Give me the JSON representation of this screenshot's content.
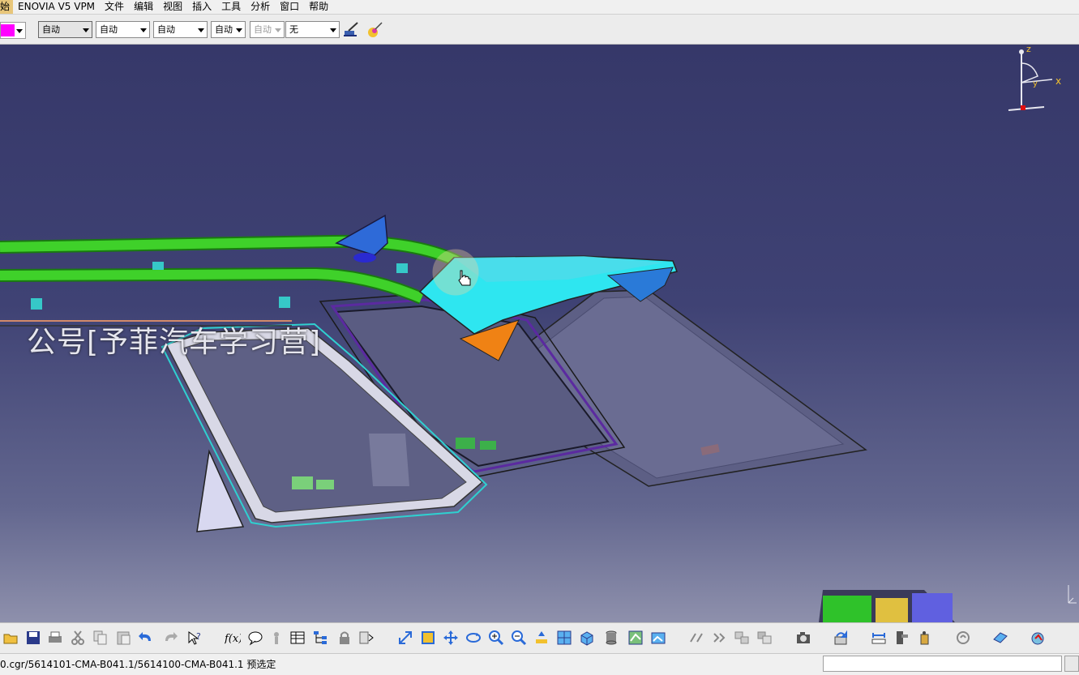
{
  "menu": [
    "始",
    "ENOVIA V5 VPM",
    "文件",
    "编辑",
    "视图",
    "插入",
    "工具",
    "分析",
    "窗口",
    "帮助"
  ],
  "top_toolbar": {
    "color_swatch": "#ff00ff",
    "dropdowns": [
      "自动",
      "自动",
      "自动",
      "自动",
      "自动",
      "无"
    ]
  },
  "watermark": "公号[予菲汽车学习营]",
  "compass": {
    "z_label": "z",
    "x_label": "x",
    "y_label": "y"
  },
  "status": {
    "path_text": "0.cgr/5614101-CMA-B041.1/5614100-CMA-B041.1 预选定",
    "command_value": ""
  },
  "bottom_toolbar_icons": [
    "open-icon",
    "save-icon",
    "print-icon",
    "cut-icon",
    "copy-icon",
    "paste-icon",
    "undo-icon",
    "redo-icon",
    "whats-this-icon",
    "formula-icon",
    "comment-icon",
    "knowledge-icon",
    "table-icon",
    "tree-icon",
    "lock-icon",
    "publish-icon",
    "fit-all-icon",
    "fly-mode-icon",
    "pan-icon",
    "rotate-icon",
    "zoom-in-icon",
    "zoom-out-icon",
    "normal-view-icon",
    "quick-view-icon",
    "iso-view-icon",
    "shading-icon",
    "hide-show-icon",
    "swap-visible-icon",
    "snap-icon",
    "manipulate-icon",
    "explode-icon",
    "clash-icon",
    "capture-icon",
    "update-icon",
    "measure-icon",
    "measure-item-icon",
    "inertia-icon",
    "cycle-icon",
    "sectioning-icon",
    "render-icon"
  ]
}
